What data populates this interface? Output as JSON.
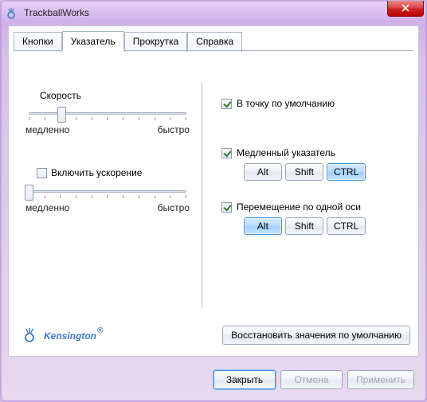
{
  "window": {
    "title": "TrackballWorks"
  },
  "tabs": [
    "Кнопки",
    "Указатель",
    "Прокрутка",
    "Справка"
  ],
  "active_tab_index": 1,
  "speed": {
    "label": "Скорость",
    "min_label": "медленно",
    "max_label": "быстро",
    "ticks": 11,
    "value_percent": 20
  },
  "accel": {
    "checkbox_label": "Включить ускорение",
    "checked": false,
    "min_label": "медленно",
    "max_label": "быстро",
    "ticks": 11,
    "value_percent": 0
  },
  "options": {
    "snap_default": {
      "label": "В точку по умолчанию",
      "checked": true
    },
    "slow_pointer": {
      "label": "Медленный указатель",
      "checked": true,
      "mods": [
        {
          "label": "Alt",
          "pressed": false
        },
        {
          "label": "Shift",
          "pressed": false
        },
        {
          "label": "CTRL",
          "pressed": true
        }
      ]
    },
    "axis_lock": {
      "label": "Перемещение по одной оси",
      "checked": true,
      "mods": [
        {
          "label": "Alt",
          "pressed": true
        },
        {
          "label": "Shift",
          "pressed": false
        },
        {
          "label": "CTRL",
          "pressed": false
        }
      ]
    }
  },
  "brand": "Kensington",
  "restore_defaults": "Восстановить значения по умолчанию",
  "buttons": {
    "close": {
      "label": "Закрыть",
      "default": true,
      "enabled": true
    },
    "cancel": {
      "label": "Отмена",
      "default": false,
      "enabled": false
    },
    "apply": {
      "label": "Применить",
      "default": false,
      "enabled": false
    }
  },
  "colors": {
    "accent": "#3d8fe0"
  }
}
